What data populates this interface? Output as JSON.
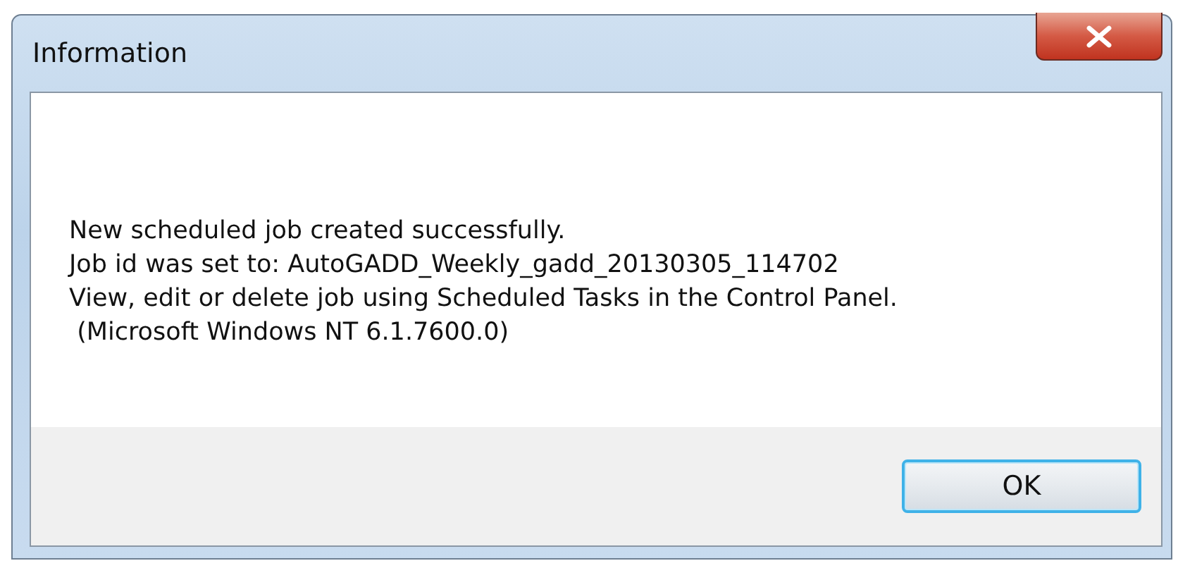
{
  "window": {
    "title": "Information"
  },
  "message_lines": [
    "New scheduled job created successfully.",
    "Job id was set to: AutoGADD_Weekly_gadd_20130305_114702",
    "View, edit or delete job using Scheduled Tasks in the Control Panel.",
    " (Microsoft Windows NT 6.1.7600.0)"
  ],
  "buttons": [
    {
      "label": "OK"
    }
  ]
}
